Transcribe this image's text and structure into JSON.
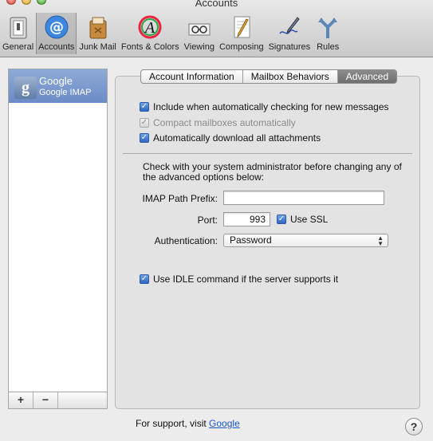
{
  "window": {
    "title": "Accounts"
  },
  "toolbar": {
    "items": [
      {
        "label": "General",
        "icon": "general-switch-icon"
      },
      {
        "label": "Accounts",
        "icon": "at-sign-icon"
      },
      {
        "label": "Junk Mail",
        "icon": "junk-mail-bin-icon"
      },
      {
        "label": "Fonts & Colors",
        "icon": "fonts-colors-icon"
      },
      {
        "label": "Viewing",
        "icon": "viewing-glasses-icon"
      },
      {
        "label": "Composing",
        "icon": "composing-pencil-icon"
      },
      {
        "label": "Signatures",
        "icon": "signature-pen-icon"
      },
      {
        "label": "Rules",
        "icon": "rules-arrows-icon"
      }
    ],
    "selected": "Accounts"
  },
  "sidebar": {
    "account_name": "Google",
    "account_type": "Google IMAP",
    "add_label": "+",
    "remove_label": "−"
  },
  "tabs": {
    "account_information": "Account Information",
    "mailbox_behaviors": "Mailbox Behaviors",
    "advanced": "Advanced",
    "active": "Advanced"
  },
  "advanced": {
    "include_auto_check": {
      "label": "Include when automatically checking for new messages",
      "checked": true
    },
    "compact_mailboxes": {
      "label": "Compact mailboxes automatically",
      "checked": true,
      "enabled": false
    },
    "auto_download": {
      "label": "Automatically download all attachments",
      "checked": true
    },
    "admin_note": "Check with your system administrator before changing any of the advanced options below:",
    "imap_prefix_label": "IMAP Path Prefix:",
    "imap_prefix_value": "",
    "port_label": "Port:",
    "port_value": "993",
    "use_ssl": {
      "label": "Use SSL",
      "checked": true
    },
    "auth_label": "Authentication:",
    "auth_value": "Password",
    "use_idle": {
      "label": "Use IDLE command if the server supports it",
      "checked": true
    }
  },
  "footer": {
    "support_text": "For support, visit",
    "support_link": "Google",
    "help_label": "?"
  },
  "colors": {
    "selection": "#7c98cc",
    "link": "#1a55c6",
    "checkbox": "#2f67c4",
    "active_tab": "#7a7a7a"
  }
}
